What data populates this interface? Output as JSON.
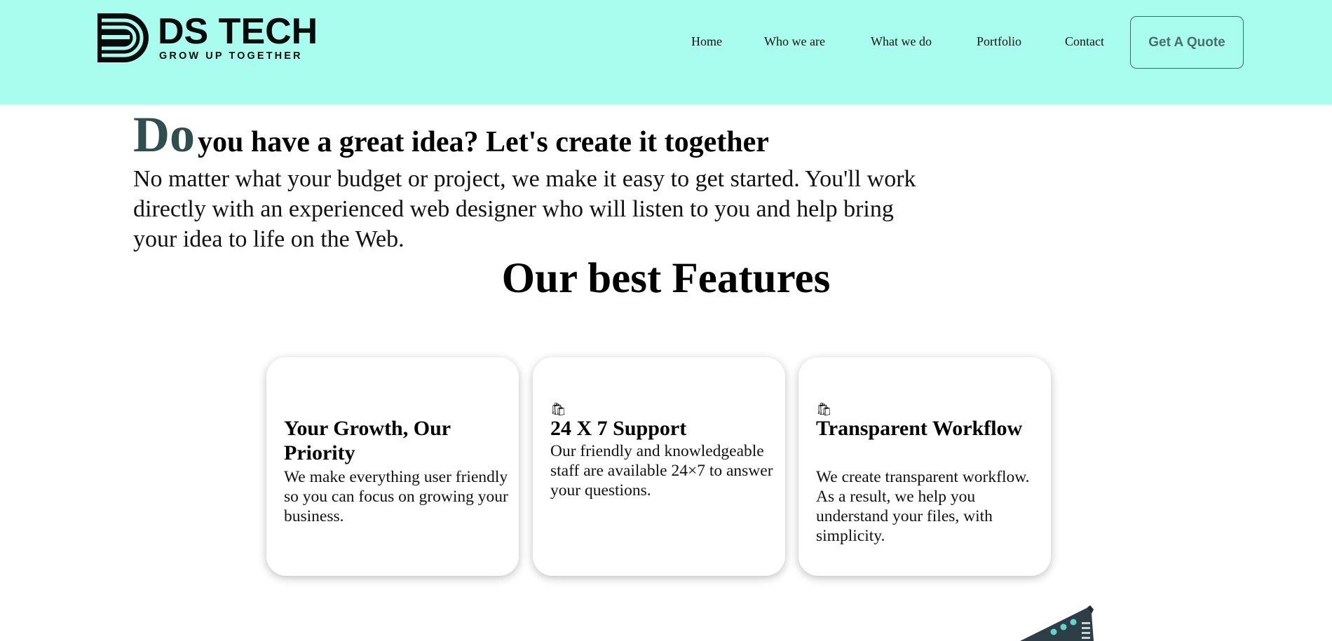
{
  "header": {
    "logo_name": "DS TECH",
    "logo_tagline": "GROW UP TOGETHER",
    "nav": [
      "Home",
      "Who we are",
      "What we do",
      "Portfolio",
      "Contact"
    ],
    "cta_label": "Get A Quote",
    "background_color": "#a8fdee"
  },
  "hero": {
    "title_first_word": "Do",
    "title_rest": "you have a great idea? Let's create it together",
    "description": "No matter what your budget or project, we make it easy to get started. You'll work directly with an experienced web designer who will listen to you and help bring your idea to life on the Web."
  },
  "features": {
    "heading": "Our best Features",
    "cards": [
      {
        "icon": "none",
        "title": "Your Growth, Our Priority",
        "text": "We make everything user friendly so you can focus on growing your business."
      },
      {
        "icon": "shopping-bag-icon",
        "title": "24 X 7 Support",
        "text": "Our friendly and knowledgeable staff are available 24×7 to answer your questions."
      },
      {
        "icon": "shopping-bag-icon",
        "title": "Transparent Workflow",
        "text": "We create transparent workflow. As a result, we help you understand your files, with simplicity."
      }
    ]
  }
}
